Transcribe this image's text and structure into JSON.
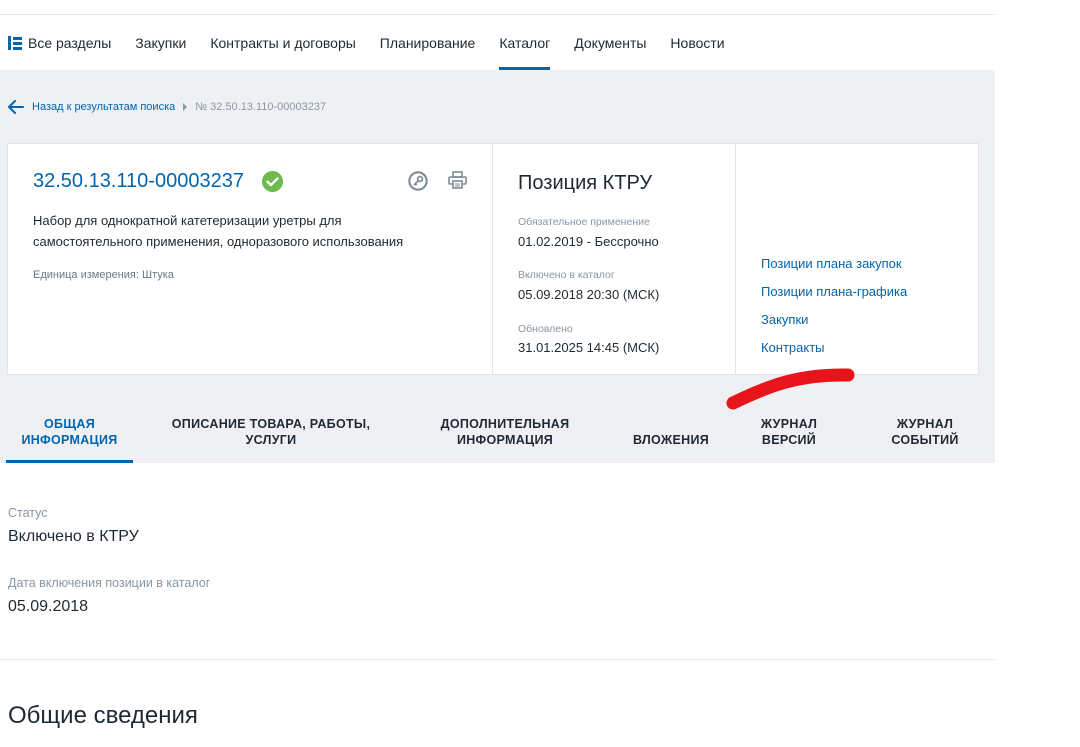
{
  "nav": {
    "items": [
      {
        "label": "Все разделы",
        "icon": "grid-icon"
      },
      {
        "label": "Закупки"
      },
      {
        "label": "Контракты и договоры"
      },
      {
        "label": "Планирование"
      },
      {
        "label": "Каталог",
        "active": true
      },
      {
        "label": "Документы"
      },
      {
        "label": "Новости"
      }
    ]
  },
  "breadcrumb": {
    "back": "Назад к результатам поиска",
    "current": "№ 32.50.13.110-00003237"
  },
  "card": {
    "code": "32.50.13.110-00003237",
    "description": "Набор для однократной катетеризации уретры для самостоятельного применения, одноразового использования",
    "unit": "Единица измерения: Штука",
    "ktru_title": "Позиция КТРУ",
    "mandatory_label": "Обязательное применение",
    "mandatory_value": "01.02.2019  - Бессрочно",
    "included_label": "Включено в каталог",
    "included_value": "05.09.2018 20:30 (МСК)",
    "updated_label": "Обновлено",
    "updated_value": "31.01.2025 14:45 (МСК)",
    "links": [
      "Позиции плана закупок",
      "Позиции плана-графика",
      "Закупки",
      "Контракты"
    ]
  },
  "tabs": [
    {
      "line1": "ОБЩАЯ",
      "line2": "ИНФОРМАЦИЯ",
      "active": true
    },
    {
      "line1": "ОПИСАНИЕ ТОВАРА, РАБОТЫ,",
      "line2": "УСЛУГИ"
    },
    {
      "line1": "ДОПОЛНИТЕЛЬНАЯ",
      "line2": "ИНФОРМАЦИЯ"
    },
    {
      "line1": "ВЛОЖЕНИЯ",
      "line2": ""
    },
    {
      "line1": "ЖУРНАЛ",
      "line2": "ВЕРСИЙ"
    },
    {
      "line1": "ЖУРНАЛ",
      "line2": "СОБЫТИЙ"
    }
  ],
  "general": {
    "status_label": "Статус",
    "status_value": "Включено в КТРУ",
    "date_label": "Дата включения позиции в каталог",
    "date_value": "05.09.2018",
    "section_title": "Общие сведения"
  },
  "colors": {
    "accent": "#0065b1",
    "success": "#6dbb4f",
    "annotation": "#e8141c"
  }
}
